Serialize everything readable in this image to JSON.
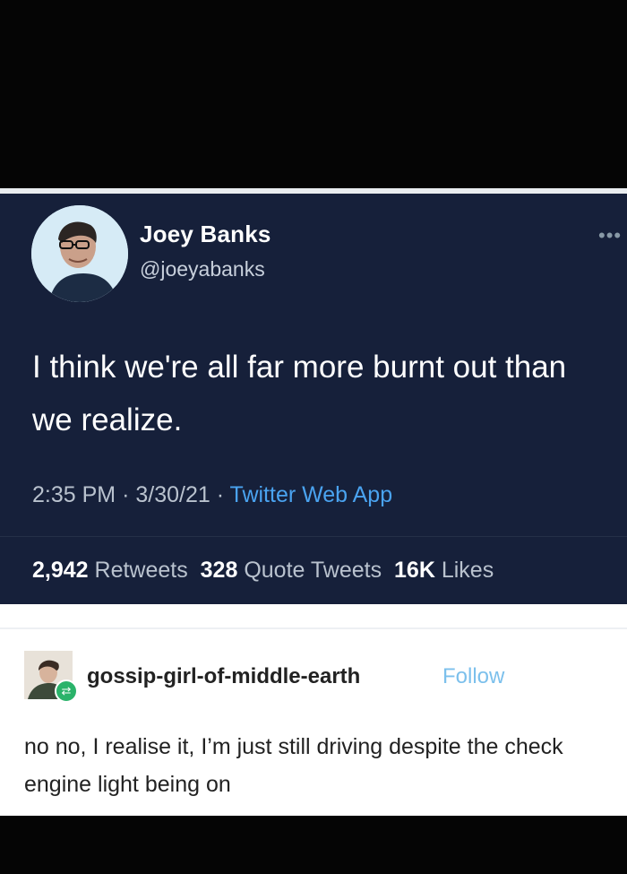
{
  "tweet": {
    "display_name": "Joey Banks",
    "handle": "@joeyabanks",
    "more_icon": "•••",
    "text": "I think we're all far more burnt out than we realize.",
    "time": "2:35 PM",
    "date": "3/30/21",
    "source": "Twitter Web App",
    "retweets_count": "2,942",
    "retweets_label": "Retweets",
    "quotes_count": "328",
    "quotes_label": "Quote Tweets",
    "likes_count": "16K",
    "likes_label": "Likes",
    "accent_color": "#4aa3f0",
    "background_color": "#16203a"
  },
  "reply": {
    "username": "gossip-girl-of-middle-earth",
    "follow_label": "Follow",
    "text": "no no, I realise it, I’m just still driving despite the check engine light being on",
    "reblog_icon": "reblog-icon",
    "follow_color": "#7cc0ec"
  }
}
